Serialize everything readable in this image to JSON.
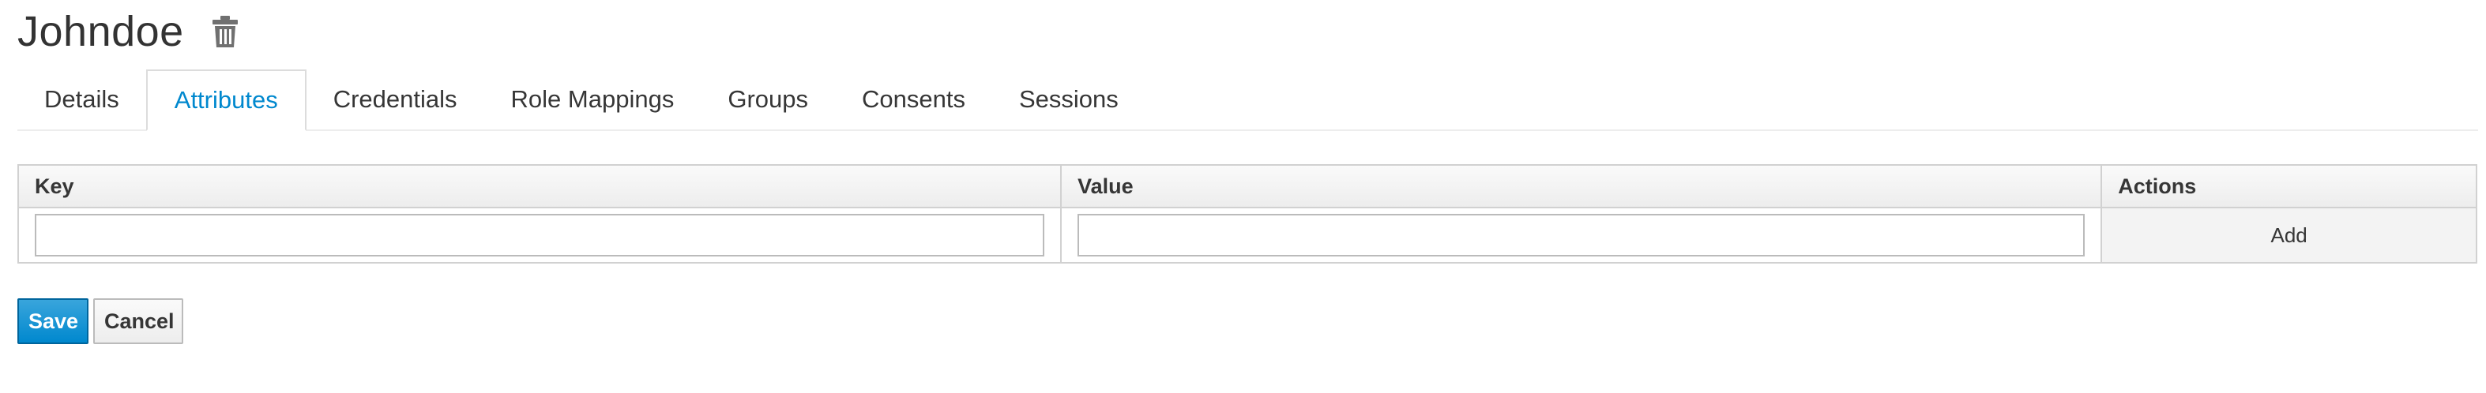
{
  "user": {
    "name": "Johndoe",
    "delete_icon": "trash-icon"
  },
  "tabs": [
    {
      "label": "Details",
      "active": false
    },
    {
      "label": "Attributes",
      "active": true
    },
    {
      "label": "Credentials",
      "active": false
    },
    {
      "label": "Role Mappings",
      "active": false
    },
    {
      "label": "Groups",
      "active": false
    },
    {
      "label": "Consents",
      "active": false
    },
    {
      "label": "Sessions",
      "active": false
    }
  ],
  "attributes_table": {
    "headers": {
      "key": "Key",
      "value": "Value",
      "actions": "Actions"
    },
    "new_row": {
      "key_value": "",
      "value_value": "",
      "add_label": "Add"
    }
  },
  "buttons": {
    "save_label": "Save",
    "cancel_label": "Cancel"
  },
  "colors": {
    "accent": "#0088ce",
    "save_bg": "#0088ce",
    "border": "#d1d1d1"
  }
}
